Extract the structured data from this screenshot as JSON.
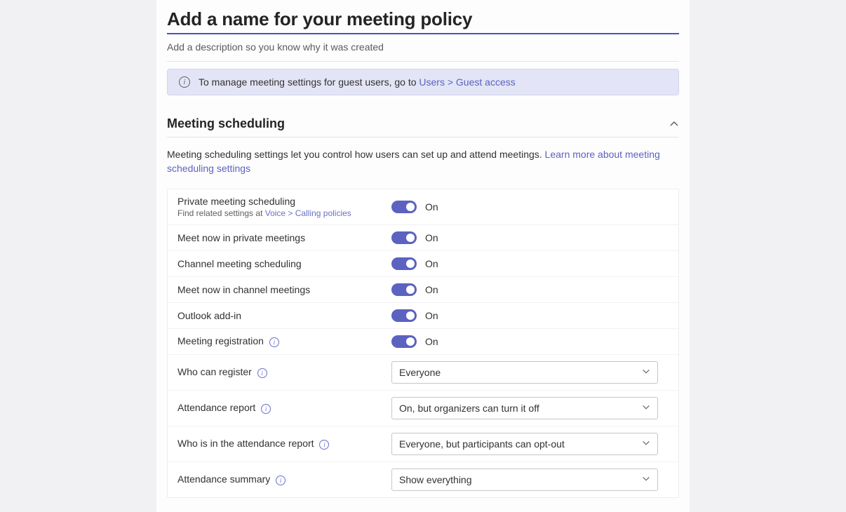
{
  "name_field": {
    "placeholder": "Add a name for your meeting policy"
  },
  "desc_field": {
    "placeholder": "Add a description so you know why it was created"
  },
  "banner": {
    "msg_pre": "To manage meeting settings for guest users, go to ",
    "link": "Users > Guest access"
  },
  "section": {
    "title": "Meeting scheduling",
    "desc_pre": "Meeting scheduling settings let you control how users can set up and attend meetings. ",
    "desc_link": "Learn more about meeting scheduling settings"
  },
  "rows": {
    "private_scheduling": {
      "label": "Private meeting scheduling",
      "sub_pre": "Find related settings at ",
      "sub_link": "Voice > Calling policies",
      "state": "On"
    },
    "meet_now_private": {
      "label": "Meet now in private meetings",
      "state": "On"
    },
    "channel_scheduling": {
      "label": "Channel meeting scheduling",
      "state": "On"
    },
    "meet_now_channel": {
      "label": "Meet now in channel meetings",
      "state": "On"
    },
    "outlook_addin": {
      "label": "Outlook add-in",
      "state": "On"
    },
    "meeting_registration": {
      "label": "Meeting registration",
      "state": "On"
    },
    "who_can_register": {
      "label": "Who can register",
      "value": "Everyone"
    },
    "attendance_report": {
      "label": "Attendance report",
      "value": "On, but organizers can turn it off"
    },
    "who_in_report": {
      "label": "Who is in the attendance report",
      "value": "Everyone, but participants can opt-out"
    },
    "attendance_summary": {
      "label": "Attendance summary",
      "value": "Show everything"
    }
  }
}
